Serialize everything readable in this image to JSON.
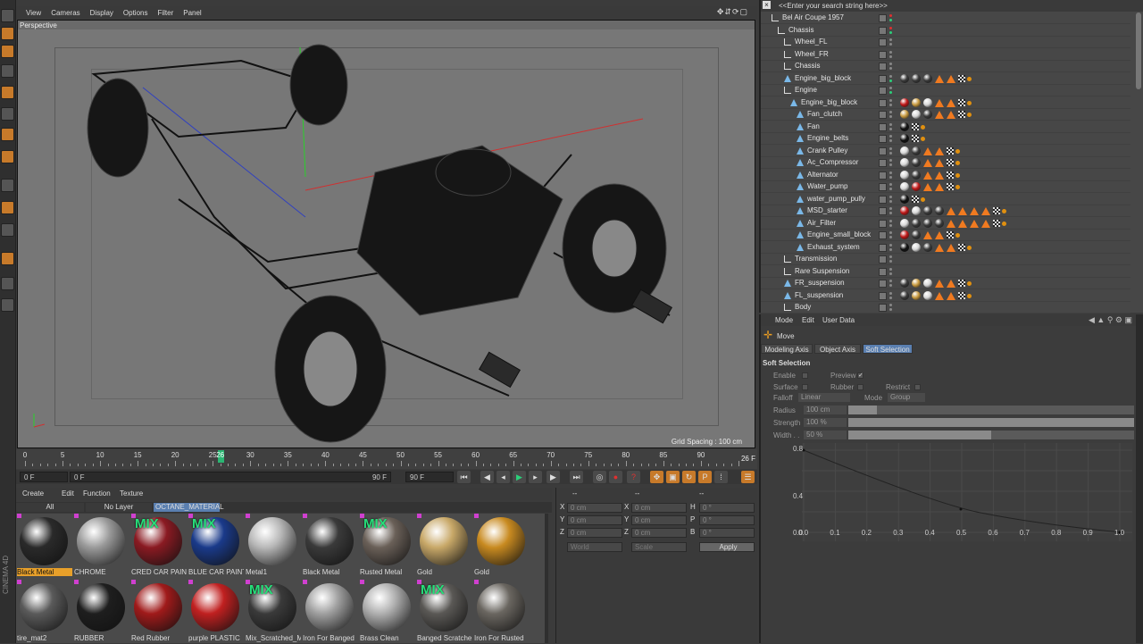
{
  "viewport_menu": {
    "items": [
      "View",
      "Cameras",
      "Display",
      "Options",
      "Filter",
      "Panel"
    ],
    "title": "Perspective",
    "grid_spacing": "Grid Spacing : 100 cm"
  },
  "timeline": {
    "ticks": [
      "0",
      "5",
      "10",
      "15",
      "20",
      "25",
      "26",
      "30",
      "35",
      "40",
      "45",
      "50",
      "55",
      "60",
      "65",
      "70",
      "75",
      "80",
      "85",
      "90"
    ],
    "current_frame": "26 F"
  },
  "transport": {
    "start": "0 F",
    "mid_start": "0 F",
    "mid_end": "90 F",
    "end": "90 F"
  },
  "material_menu": {
    "items": [
      "Create",
      "Edit",
      "Function",
      "Texture"
    ],
    "tabs": [
      "All",
      "No Layer",
      "OCTANE_MATERIAL"
    ]
  },
  "materials": [
    {
      "name": "Black Metal",
      "mix": false,
      "selected": true,
      "color": "#2a2a2a"
    },
    {
      "name": "CHROME",
      "mix": false,
      "selected": false,
      "color": "#9a9a9a"
    },
    {
      "name": "CRED CAR PAINT",
      "mix": true,
      "selected": false,
      "color": "#8a1a22"
    },
    {
      "name": "BLUE CAR PAINT",
      "mix": true,
      "selected": false,
      "color": "#1a3a8a"
    },
    {
      "name": "Metal1",
      "mix": false,
      "selected": false,
      "color": "#b8b8b8"
    },
    {
      "name": "Black Metal",
      "mix": false,
      "selected": false,
      "color": "#3a3a3a"
    },
    {
      "name": "Rusted Metal",
      "mix": true,
      "selected": false,
      "color": "#6a6058"
    },
    {
      "name": "Gold",
      "mix": false,
      "selected": false,
      "color": "#c8a868"
    },
    {
      "name": "Gold",
      "mix": false,
      "selected": false,
      "color": "#c88a20"
    },
    {
      "name": "tire_mat2",
      "mix": false,
      "selected": false,
      "color": "#5a5a5a"
    },
    {
      "name": "RUBBER",
      "mix": false,
      "selected": false,
      "color": "#1e1e1e"
    },
    {
      "name": "Red Rubber",
      "mix": false,
      "selected": false,
      "color": "#a01a1a"
    },
    {
      "name": "purple PLASTIC",
      "mix": false,
      "selected": false,
      "color": "#c02020"
    },
    {
      "name": "Mix_Scratched_M",
      "mix": true,
      "selected": false,
      "color": "#3a3a3a"
    },
    {
      "name": "Iron For Banged",
      "mix": false,
      "selected": false,
      "color": "#a0a0a0"
    },
    {
      "name": "Brass Clean",
      "mix": false,
      "selected": false,
      "color": "#b0b0b0"
    },
    {
      "name": "Banged Scratche",
      "mix": true,
      "selected": false,
      "color": "#5a5855"
    },
    {
      "name": "Iron For Rusted",
      "mix": false,
      "selected": false,
      "color": "#6a6660"
    }
  ],
  "coordinates": {
    "header": [
      "--",
      "--",
      "--"
    ],
    "rows": [
      {
        "a": "X",
        "av": "0 cm",
        "b": "X",
        "bv": "0 cm",
        "c": "H",
        "cv": "0 °"
      },
      {
        "a": "Y",
        "av": "0 cm",
        "b": "Y",
        "bv": "0 cm",
        "c": "P",
        "cv": "0 °"
      },
      {
        "a": "Z",
        "av": "0 cm",
        "b": "Z",
        "bv": "0 cm",
        "c": "B",
        "cv": "0 °"
      }
    ],
    "mode": "World",
    "scale": "Scale",
    "apply": "Apply"
  },
  "objects": {
    "search_placeholder": "<<Enter your search string here>>",
    "rows": [
      {
        "name": "Bel Air Coupe 1957",
        "indent": 0,
        "icon": "null",
        "tags": ""
      },
      {
        "name": "Chassis",
        "indent": 1,
        "icon": "null",
        "tags": ""
      },
      {
        "name": "Wheel_FL",
        "indent": 2,
        "icon": "null",
        "tags": ""
      },
      {
        "name": "Wheel_FR",
        "indent": 2,
        "icon": "null",
        "tags": ""
      },
      {
        "name": "Chassis",
        "indent": 2,
        "icon": "null",
        "tags": ""
      },
      {
        "name": "Engine_big_block",
        "indent": 2,
        "icon": "poly",
        "tags": "bbb^^c."
      },
      {
        "name": "Engine",
        "indent": 2,
        "icon": "null",
        "tags": ""
      },
      {
        "name": "Engine_big_block",
        "indent": 3,
        "icon": "poly",
        "tags": "rgw^^c."
      },
      {
        "name": "Fan_clutch",
        "indent": 4,
        "icon": "poly",
        "tags": "gwb^^c."
      },
      {
        "name": "Fan",
        "indent": 4,
        "icon": "poly",
        "tags": "kc."
      },
      {
        "name": "Engine_belts",
        "indent": 4,
        "icon": "poly",
        "tags": "kc."
      },
      {
        "name": "Crank Pulley",
        "indent": 4,
        "icon": "poly",
        "tags": "wb^^c."
      },
      {
        "name": "Ac_Compressor",
        "indent": 4,
        "icon": "poly",
        "tags": "wb^^c."
      },
      {
        "name": "Alternator",
        "indent": 4,
        "icon": "poly",
        "tags": "wb^^c."
      },
      {
        "name": "Water_pump",
        "indent": 4,
        "icon": "poly",
        "tags": "wr^^c."
      },
      {
        "name": "water_pump_pully",
        "indent": 4,
        "icon": "poly",
        "tags": "kc."
      },
      {
        "name": "MSD_starter",
        "indent": 4,
        "icon": "poly",
        "tags": "rwbb^^^^c."
      },
      {
        "name": "Air_Filter",
        "indent": 4,
        "icon": "poly",
        "tags": "wbbb^^^^c."
      },
      {
        "name": "Engine_small_block",
        "indent": 4,
        "icon": "poly",
        "tags": "rb^^c."
      },
      {
        "name": "Exhaust_system",
        "indent": 4,
        "icon": "poly",
        "tags": "kwb^^c."
      },
      {
        "name": "Transmission",
        "indent": 2,
        "icon": "null",
        "tags": ""
      },
      {
        "name": "Rare Suspension",
        "indent": 2,
        "icon": "null",
        "tags": ""
      },
      {
        "name": "FR_suspension",
        "indent": 2,
        "icon": "poly",
        "tags": "bgw^^c."
      },
      {
        "name": "FL_suspension",
        "indent": 2,
        "icon": "poly",
        "tags": "bgw^^c."
      },
      {
        "name": "Body",
        "indent": 2,
        "icon": "null",
        "tags": ""
      }
    ]
  },
  "attributes": {
    "menu": [
      "Mode",
      "Edit",
      "User Data"
    ],
    "tool": "Move",
    "tabs": [
      "Modeling Axis",
      "Object Axis",
      "Soft Selection"
    ],
    "section": "Soft Selection",
    "enable": "Enable",
    "preview": "Preview",
    "surface": "Surface",
    "rubber": "Rubber",
    "restrict": "Restrict",
    "falloff": "Falloff",
    "falloff_val": "Linear",
    "mode": "Mode",
    "mode_val": "Group",
    "radius": "Radius",
    "radius_val": "100 cm",
    "radius_fill": 0.1,
    "strength": "Strength",
    "strength_val": "100 %",
    "strength_fill": 1.0,
    "width": "Width . .",
    "width_val": "50 %",
    "width_fill": 0.5,
    "graph_x": [
      "0.0",
      "0.1",
      "0.2",
      "0.3",
      "0.4",
      "0.5",
      "0.6",
      "0.7",
      "0.8",
      "0.9",
      "1.0"
    ],
    "graph_y": [
      "0.8",
      "0.4",
      "0.0"
    ]
  },
  "side_label": "CINEMA 4D"
}
